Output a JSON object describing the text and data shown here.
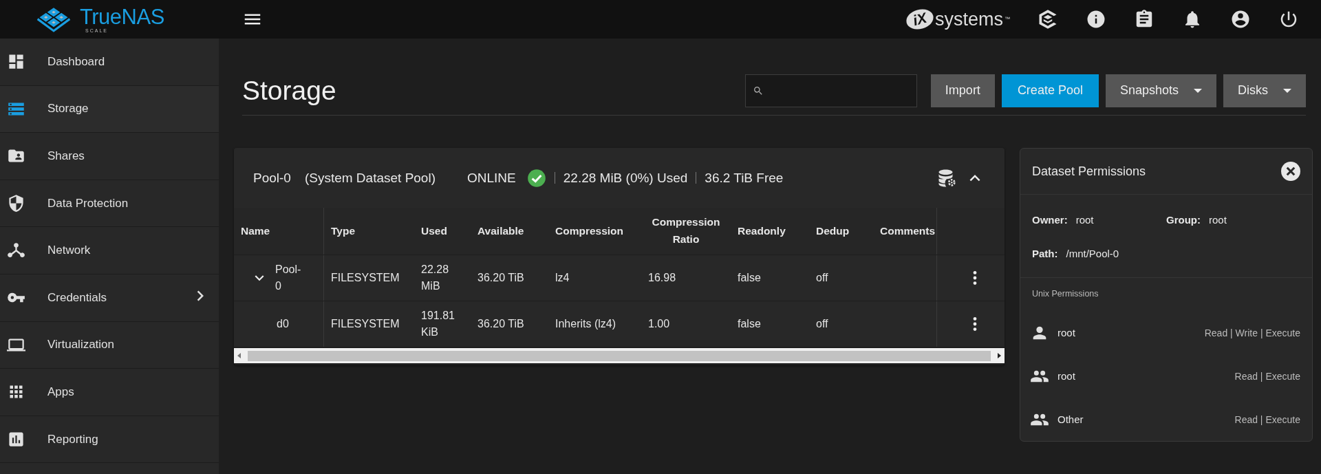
{
  "topbar": {
    "logo": {
      "name": "TrueNAS",
      "edition": "SCALE"
    },
    "vendor": {
      "mark": "iX",
      "name": "systems",
      "trademark": "™"
    }
  },
  "sidebar": {
    "items": [
      {
        "label": "Dashboard",
        "selected": false,
        "has_submenu": false
      },
      {
        "label": "Storage",
        "selected": true,
        "has_submenu": false
      },
      {
        "label": "Shares",
        "selected": false,
        "has_submenu": false
      },
      {
        "label": "Data Protection",
        "selected": false,
        "has_submenu": false
      },
      {
        "label": "Network",
        "selected": false,
        "has_submenu": false
      },
      {
        "label": "Credentials",
        "selected": false,
        "has_submenu": true
      },
      {
        "label": "Virtualization",
        "selected": false,
        "has_submenu": false
      },
      {
        "label": "Apps",
        "selected": false,
        "has_submenu": false
      },
      {
        "label": "Reporting",
        "selected": false,
        "has_submenu": false
      }
    ]
  },
  "page": {
    "title": "Storage",
    "buttons": [
      {
        "label": "Import",
        "kind": "plain"
      },
      {
        "label": "Create Pool",
        "kind": "primary"
      },
      {
        "label": "Snapshots",
        "kind": "menu"
      },
      {
        "label": "Disks",
        "kind": "menu"
      }
    ]
  },
  "pool": {
    "name": "Pool-0",
    "note": "(System Dataset Pool)",
    "status": "ONLINE",
    "healthy": true,
    "used": "22.28 MiB (0%) Used",
    "free": "36.2 TiB Free",
    "expanded": true,
    "table": {
      "columns": [
        "Name",
        "Type",
        "Used",
        "Available",
        "Compression",
        "Compression Ratio",
        "Readonly",
        "Dedup",
        "Comments"
      ],
      "rows": [
        {
          "name": "Pool-0",
          "type": "FILESYSTEM",
          "used": "22.28 MiB",
          "available": "36.20 TiB",
          "compression": "lz4",
          "ratio": "16.98",
          "readonly": "false",
          "dedup": "off",
          "expanded": true,
          "children": [
            {
              "name": "d0",
              "type": "FILESYSTEM",
              "used": "191.81 KiB",
              "available": "36.20 TiB",
              "compression": "Inherits (lz4)",
              "ratio": "1.00",
              "readonly": "false",
              "dedup": "off"
            }
          ]
        }
      ]
    }
  },
  "permissions": {
    "title": "Dataset Permissions",
    "owner_label": "Owner:",
    "owner": "root",
    "group_label": "Group:",
    "group": "root",
    "path_label": "Path:",
    "path": "/mnt/Pool-0",
    "section": "Unix Permissions",
    "entries": [
      {
        "kind": "user",
        "name": "root",
        "access": "Read | Write | Execute"
      },
      {
        "kind": "group",
        "name": "root",
        "access": "Read | Execute"
      },
      {
        "kind": "other",
        "name": "Other",
        "access": "Read | Execute"
      }
    ]
  }
}
